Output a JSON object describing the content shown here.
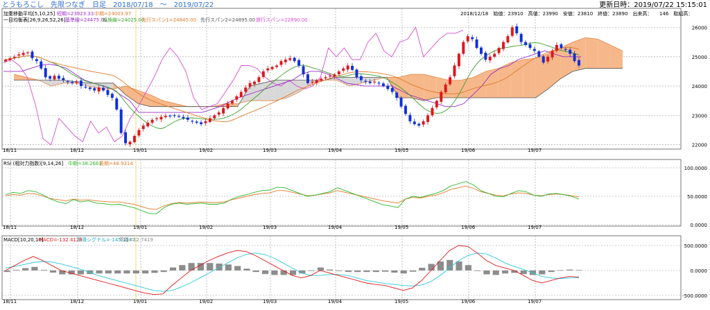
{
  "header": {
    "title": "とうもろこし　先限つなぎ　日足　2018/07/18　〜　2019/07/22",
    "updated": "更新日時：2019/07/22 15:15:01"
  },
  "colors": {
    "bull": "#e0161b",
    "bear": "#1030d8",
    "ma5": "#9b2cc9",
    "ma10": "#2a7fd6",
    "ma25": "#e07a2a",
    "tenkan": "#3aa02a",
    "kijun": "#9b2cc9",
    "chikou": "#d34fd0",
    "kumo_up": "#f6b88a",
    "kumo_dn": "#d8d8d8",
    "rsi_mid": "#2ab82a",
    "rsi_long": "#e07a2a",
    "macd": "#e0161b",
    "signal": "#28c8d8",
    "osc": "#8c8c8c",
    "today": "#f4e79a"
  },
  "main": {
    "legend_ma": {
      "label": "加重移動平均[5,10,25]",
      "ma5": "短期=23923.33",
      "ma10": "中期=24003.97"
    },
    "legend_ichi": {
      "label": "一目均衡表[26,9,26,52,26]",
      "kijun": "基準線=24475.00",
      "tenkan": "転換線=24025.00",
      "senkou1": "先行スパン1=24845.00",
      "senkou2": "先行スパン2=24895.00",
      "chikou": "遅行スパン=22890.00"
    },
    "ohlc": "2018/12/18　始値：23910　高値：23990　安値：23810　終値：23890　出来高：　　146　取組高：",
    "y_ticks": [
      "26000",
      "25000",
      "24000",
      "23000",
      "22000"
    ],
    "x_ticks": [
      "18/11",
      "18/12",
      "19/01",
      "19/02",
      "19/03",
      "19/04",
      "19/05",
      "19/06",
      "19/07"
    ]
  },
  "rsi": {
    "label": "RSI (相対力指数)[9,14,26]",
    "mid": "中期=38.2663",
    "long": "長期=48.9314",
    "y_ticks": [
      "100.0000",
      "50.0000",
      "0.0000"
    ],
    "x_ticks": [
      "18/11",
      "18/12",
      "19/01",
      "19/02",
      "19/03",
      "19/04",
      "19/05",
      "19/06",
      "19/07"
    ]
  },
  "macd": {
    "label": "MACD[10,20,10]",
    "macd": "MACD=-132.4129",
    "signal": "平滑シグナル=-145.1547",
    "osc": "乖離=12.7419",
    "y_ticks": [
      "500.0000",
      "0.0000",
      "-500.0000"
    ],
    "x_ticks": [
      "18/11",
      "18/12",
      "19/01",
      "19/02",
      "19/03",
      "19/04",
      "19/05",
      "19/06",
      "19/07"
    ]
  },
  "chart_data": [
    {
      "type": "candlestick",
      "title": "とうもろこし　先限つなぎ　日足",
      "x_ticks": [
        "18/11",
        "18/12",
        "19/01",
        "19/02",
        "19/03",
        "19/04",
        "19/05",
        "19/06",
        "19/07"
      ],
      "ylim": [
        21850,
        26650
      ],
      "close": [
        24900,
        24950,
        25000,
        25080,
        25130,
        25150,
        24950,
        24850,
        24600,
        24300,
        24250,
        24350,
        24250,
        24200,
        24150,
        24100,
        24150,
        24000,
        23950,
        23900,
        23850,
        23950,
        23850,
        23700,
        23600,
        23200,
        22400,
        22050,
        22100,
        22300,
        22500,
        22650,
        22750,
        22850,
        22900,
        22950,
        22980,
        22970,
        23000,
        22950,
        22900,
        22850,
        22800,
        22750,
        22700,
        22800,
        22900,
        23000,
        23100,
        23250,
        23400,
        23500,
        23650,
        23800,
        23950,
        24100,
        24150,
        24300,
        24500,
        24600,
        24650,
        24700,
        24850,
        24900,
        24950,
        24850,
        24700,
        24400,
        24100,
        24150,
        24200,
        24250,
        24300,
        24350,
        24400,
        24500,
        24600,
        24700,
        24550,
        24300,
        24200,
        24150,
        24100,
        24150,
        24100,
        24000,
        23900,
        23800,
        23600,
        23300,
        23050,
        22800,
        22700,
        22650,
        22800,
        23000,
        23250,
        23500,
        23800,
        24050,
        24300,
        24700,
        25100,
        25500,
        25700,
        25600,
        25300,
        25100,
        24900,
        25000,
        25100,
        25300,
        25500,
        25700,
        26000,
        25800,
        25500,
        25400,
        25300,
        25200,
        25000,
        24800,
        25000,
        25200,
        25400,
        25300,
        25250,
        25100,
        24850,
        24700
      ],
      "kijun": [
        24500,
        24500,
        24500,
        24600,
        24700,
        24750,
        24700,
        24600,
        24400,
        24200,
        24100,
        24000,
        23900,
        23700,
        23500,
        23100,
        23100,
        23100,
        23100,
        23100,
        23100,
        23100,
        23100,
        23200,
        23300,
        23450,
        23600,
        23700,
        23800,
        23900,
        24000,
        24100,
        24200,
        24400,
        24500,
        24500,
        24400,
        24250,
        24100,
        24050,
        24000,
        24000,
        24000,
        24000,
        23850,
        23700,
        23600,
        23500,
        23400,
        23300,
        23300,
        23400,
        23700,
        24000,
        24400,
        24600,
        24700,
        24900,
        25000,
        25100,
        25200,
        25100,
        25000,
        25000,
        25000
      ],
      "chikou": [
        24800,
        24900,
        24700,
        24300,
        23400,
        22200,
        22000,
        22900,
        22600,
        22300,
        22100,
        22800,
        22400,
        22600,
        22100,
        22300,
        22900,
        23300,
        23800,
        24300,
        24900,
        25300,
        25000,
        24500,
        23600,
        23200,
        23300,
        23400,
        23800,
        24200,
        24700,
        24700,
        24600,
        24300,
        24100,
        24000,
        24200,
        24000,
        23900,
        24000,
        24300,
        25300,
        25000,
        25300,
        24900,
        24900,
        25500,
        25800,
        25200,
        25000,
        25500,
        25600,
        26000,
        25000,
        25300,
        25600,
        25800,
        25800,
        25900
      ],
      "senkou_a": [
        24400,
        24300,
        24200,
        24000,
        24100,
        24100,
        24000,
        23900,
        23900,
        24000,
        23850,
        23700,
        23500,
        23400,
        23300,
        23300,
        23300,
        23400,
        23400,
        23500,
        23500,
        23500,
        23600,
        23800,
        24100,
        24200,
        24200,
        24000,
        24100,
        24200,
        24300,
        24300,
        24400,
        24400,
        24300,
        24200,
        24200,
        24300,
        24500,
        24600,
        24800,
        24900,
        24950,
        25100,
        25300,
        25500,
        25650,
        25600,
        25400,
        25200
      ],
      "senkou_b": [
        24200,
        24200,
        24200,
        24200,
        24200,
        24150,
        24100,
        24100,
        24100,
        23700,
        23400,
        23300,
        23300,
        23300,
        23300,
        23300,
        23300,
        23300,
        23300,
        24000,
        24100,
        24200,
        24200,
        24200,
        24200,
        24200,
        24300,
        24300,
        24300,
        24300,
        24300,
        23600,
        23600,
        23500,
        23600,
        23600,
        23600,
        23600,
        23600,
        23600,
        23600,
        23600,
        23600,
        23900,
        24250,
        24500,
        24600,
        24600,
        24600,
        24600
      ]
    },
    {
      "type": "line",
      "title": "RSI (相対力指数)[9,14,26]",
      "ylim": [
        0,
        100
      ],
      "series": [
        {
          "name": "中期",
          "values": [
            53,
            57,
            55,
            60,
            58,
            52,
            45,
            40,
            37,
            44,
            40,
            42,
            38,
            37,
            35,
            36,
            33,
            30,
            25,
            20,
            19,
            30,
            36,
            38,
            36,
            37,
            38,
            36,
            36,
            38,
            45,
            50,
            53,
            57,
            60,
            61,
            66,
            65,
            60,
            55,
            50,
            52,
            55,
            58,
            65,
            60,
            55,
            50,
            45,
            40,
            35,
            33,
            30,
            45,
            50,
            48,
            52,
            55,
            60,
            68,
            72,
            76,
            70,
            60,
            55,
            50,
            49,
            55,
            60,
            58,
            52,
            50,
            54,
            55,
            53,
            50,
            45
          ]
        },
        {
          "name": "長期",
          "values": [
            51,
            53,
            52,
            55,
            54,
            50,
            46,
            44,
            42,
            45,
            43,
            44,
            42,
            41,
            40,
            40,
            38,
            36,
            32,
            28,
            27,
            33,
            37,
            39,
            38,
            39,
            40,
            39,
            39,
            40,
            44,
            47,
            50,
            53,
            55,
            56,
            60,
            60,
            57,
            54,
            51,
            52,
            54,
            56,
            60,
            57,
            54,
            51,
            48,
            45,
            42,
            40,
            38,
            45,
            48,
            47,
            50,
            52,
            56,
            62,
            65,
            68,
            64,
            58,
            55,
            52,
            51,
            54,
            56,
            55,
            52,
            51,
            53,
            54,
            53,
            51,
            49
          ]
        }
      ]
    },
    {
      "type": "line",
      "title": "MACD[10,20,10]",
      "ylim": [
        -500,
        500
      ],
      "series": [
        {
          "name": "MACD",
          "values": [
            0,
            100,
            200,
            280,
            200,
            100,
            0,
            -50,
            -100,
            -150,
            -200,
            -250,
            -300,
            -350,
            -400,
            -450,
            -480,
            -470,
            -300,
            -150,
            0,
            100,
            200,
            280,
            350,
            400,
            380,
            300,
            200,
            100,
            0,
            -100,
            -150,
            -100,
            0,
            -50,
            -100,
            -150,
            -200,
            -250,
            -280,
            -300,
            -350,
            -400,
            -350,
            -200,
            0,
            200,
            400,
            500,
            480,
            350,
            200,
            100,
            50,
            0,
            -100,
            -200,
            -250,
            -200,
            -150,
            -120,
            -130
          ]
        },
        {
          "name": "平滑シグナル",
          "values": [
            50,
            80,
            120,
            160,
            180,
            170,
            130,
            80,
            30,
            -30,
            -100,
            -150,
            -200,
            -250,
            -300,
            -350,
            -400,
            -420,
            -400,
            -330,
            -250,
            -150,
            -50,
            50,
            150,
            250,
            320,
            350,
            320,
            250,
            150,
            50,
            -50,
            -100,
            -100,
            -80,
            -80,
            -100,
            -150,
            -200,
            -230,
            -260,
            -280,
            -300,
            -310,
            -290,
            -220,
            -100,
            50,
            200,
            300,
            350,
            330,
            250,
            150,
            80,
            20,
            -50,
            -120,
            -150,
            -160,
            -150,
            -145
          ]
        }
      ],
      "oscillator": {
        "name": "乖離",
        "values": [
          -50,
          20,
          80,
          120,
          20,
          -70,
          -130,
          -130,
          -130,
          -120,
          -100,
          -100,
          -100,
          -100,
          -100,
          -100,
          -80,
          -50,
          100,
          180,
          250,
          250,
          250,
          230,
          200,
          150,
          60,
          -50,
          -120,
          -150,
          -150,
          -150,
          -100,
          0,
          100,
          30,
          -20,
          -50,
          -50,
          -50,
          -50,
          -40,
          -70,
          -100,
          -40,
          90,
          220,
          300,
          350,
          300,
          180,
          0,
          -130,
          -150,
          -100,
          -80,
          -120,
          -150,
          -130,
          -50,
          10,
          30,
          13
        ]
      }
    }
  ]
}
